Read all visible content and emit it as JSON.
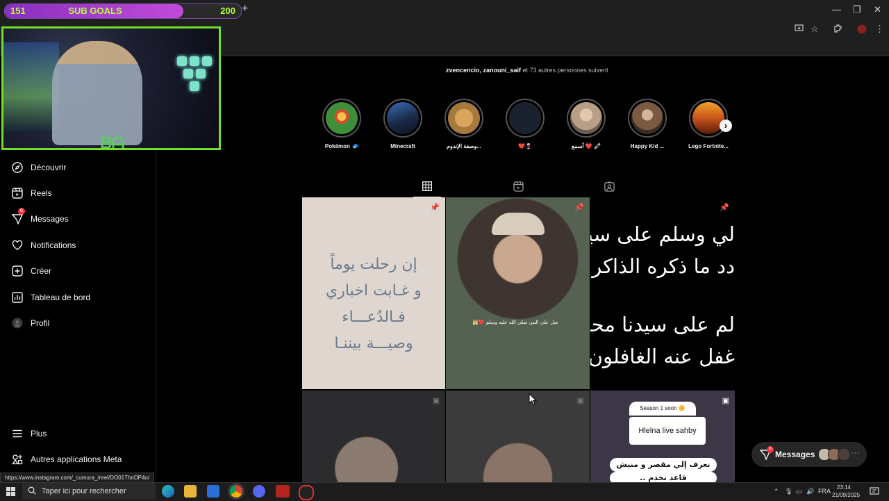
{
  "browser": {
    "subgoal": {
      "left_count": "151",
      "title": "SUB GOALS",
      "right_count": "200",
      "progress": 0.755
    },
    "new_tab": "+",
    "window_controls": [
      "—",
      "❐",
      "✕"
    ]
  },
  "sidebar": {
    "items": [
      {
        "label": "Découvrir",
        "icon": "compass-icon"
      },
      {
        "label": "Reels",
        "icon": "reels-icon"
      },
      {
        "label": "Messages",
        "icon": "messenger-icon",
        "badge": "6"
      },
      {
        "label": "Notifications",
        "icon": "heart-icon"
      },
      {
        "label": "Créer",
        "icon": "plus-square-icon"
      },
      {
        "label": "Tableau de bord",
        "icon": "dashboard-icon"
      },
      {
        "label": "Profil",
        "icon": "avatar"
      }
    ],
    "bottom": [
      {
        "label": "Plus",
        "icon": "menu-icon"
      },
      {
        "label": "Autres applications Meta",
        "icon": "meta-apps-icon"
      }
    ]
  },
  "profile": {
    "followed_by": {
      "users": "zvencencio, zanouni_saif",
      "rest": " et 73 autres personnes suivent"
    }
  },
  "highlights": [
    {
      "label": "Pokémon 🧢",
      "color": "#3f8f3a"
    },
    {
      "label": "Minecraft",
      "color": "#2d4f86"
    },
    {
      "label": "وصفة الإندوم...",
      "color": "#a67a3f"
    },
    {
      "label": "❤️🍷",
      "color": "#1a2230"
    },
    {
      "label": "أسمع ❤️ 🖍",
      "color": "#b89f86"
    },
    {
      "label": "Happy Kid ...",
      "color": "#7b5a44"
    },
    {
      "label": "Lego Fortnite...",
      "color": "#c8541b"
    }
  ],
  "tabs": [
    "grid-icon",
    "reels-tab-icon",
    "tagged-icon"
  ],
  "posts": {
    "p1": {
      "lines": [
        "إن رحلت يوماً",
        "و غـابت اخباري",
        "فـالدُعـــاء",
        "وصيـــة بيننـا"
      ]
    },
    "p2": {
      "caption": "صل على النبي صلى الله عليه وسلم ❤️🕌"
    },
    "p3": {
      "top_lines": [
        "لي وسلم على سيد",
        "دد ما ذكره الذاكرو"
      ],
      "bottom_lines": [
        "لم على سيدنا محم",
        "غفل عنه الغافلون"
      ]
    },
    "p6": {
      "season": "Season 1 soon 🌼",
      "title": "Hlelna live sahby",
      "line1": "نعرف إلي مقصر و منيش",
      "line2": "قاعد نخدم .."
    }
  },
  "floating_messages": {
    "label": "Messages",
    "badge": "6",
    "more": "···"
  },
  "status_url": "https://www.instagram.com/_cumura_/reel/DO01ThnDP4o/",
  "taskbar": {
    "search_placeholder": "Taper ici pour rechercher",
    "lang": "FRA",
    "time": "23:14",
    "date": "21/09/2025"
  }
}
